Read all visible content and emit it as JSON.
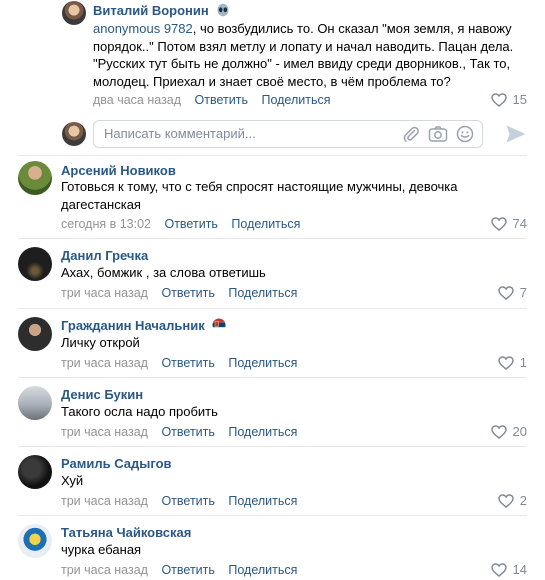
{
  "thread": {
    "author": "Виталий Воронин",
    "author_badge": "alien-emoji",
    "mention": "anonymous 9782",
    "text": ", чо возбудились то. Он сказал \"моя земля, я навожу порядок..\" Потом взял метлу и лопату и начал наводить. Пацан дела. \"Русских тут быть не должно\" - имел ввиду среди дворников., Так то, молодец. Приехал и знает своё место, в чём проблема то?",
    "time": "два часа назад",
    "reply": "Ответить",
    "share": "Поделиться",
    "likes": "15"
  },
  "composer": {
    "placeholder": "Написать комментарий...",
    "icons": [
      "paperclip-icon",
      "camera-icon",
      "smile-icon",
      "send-icon"
    ]
  },
  "comments": [
    {
      "author": "Арсений Новиков",
      "text": "Готовься к тому, что с тебя спросят настоящие мужчины, девочка дагестанская",
      "time": "сегодня в 13:02",
      "reply": "Ответить",
      "share": "Поделиться",
      "likes": "74"
    },
    {
      "author": "Данил Гречка",
      "text": "Ахах, бомжик , за слова ответишь",
      "time": "три часа назад",
      "reply": "Ответить",
      "share": "Поделиться",
      "likes": "7"
    },
    {
      "author": "Гражданин Начальник",
      "author_badge": "serbia-flag-emoji",
      "text": "Личку открой",
      "time": "три часа назад",
      "reply": "Ответить",
      "share": "Поделиться",
      "likes": "1"
    },
    {
      "author": "Денис Букин",
      "text": "Такого осла надо пробить",
      "time": "три часа назад",
      "reply": "Ответить",
      "share": "Поделиться",
      "likes": "20"
    },
    {
      "author": "Рамиль Садыгов",
      "text": "Хуй",
      "time": "три часа назад",
      "reply": "Ответить",
      "share": "Поделиться",
      "likes": "2"
    },
    {
      "author": "Татьяна Чайковская",
      "text": "чурка ебаная",
      "time": "три часа назад",
      "reply": "Ответить",
      "share": "Поделиться",
      "likes": "14"
    }
  ],
  "colors": {
    "link": "#2a5885",
    "meta": "#939393",
    "icon": "#828a99",
    "divider": "#e7e8ec"
  }
}
